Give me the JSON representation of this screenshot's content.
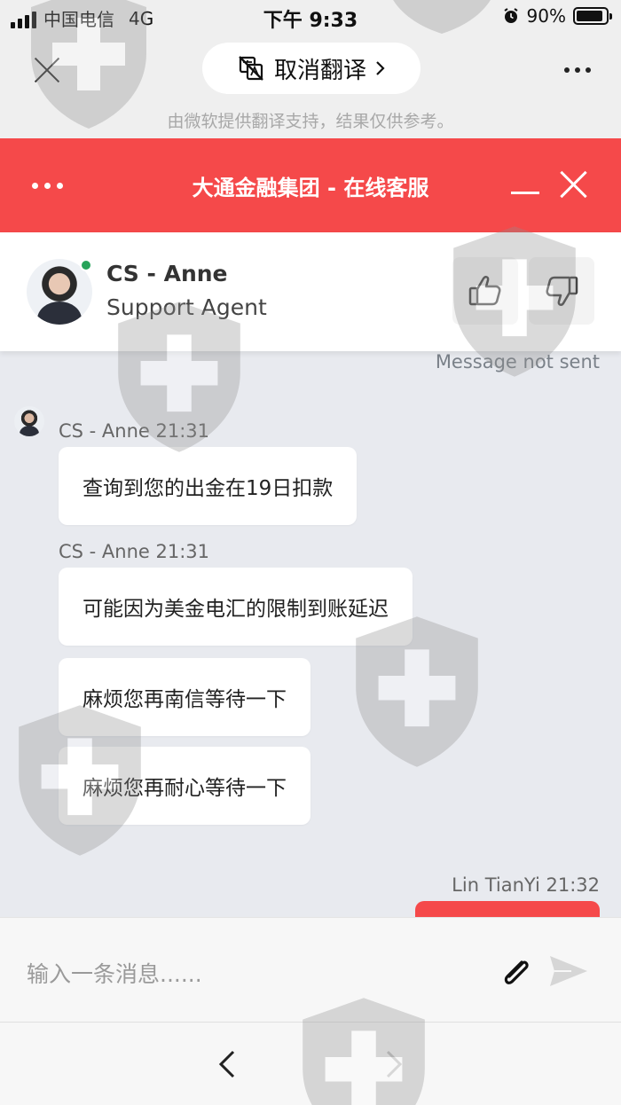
{
  "status_bar": {
    "carrier": "中国电信",
    "network": "4G",
    "time": "下午 9:33",
    "battery": "90%",
    "battery_level": 0.9
  },
  "translate_bar": {
    "pill_label": "取消翻译",
    "note": "由微软提供翻译支持，结果仅供参考。"
  },
  "chat_header": {
    "title": "大通金融集团 - 在线客服"
  },
  "agent": {
    "name": "CS - Anne",
    "role": "Support Agent"
  },
  "messages": {
    "not_sent": "Message not sent",
    "group1_meta": "CS - Anne 21:31",
    "group1_bubble": "查询到您的出金在19日扣款",
    "group2_meta": "CS - Anne 21:31",
    "group2_bubble1": "可能因为美金电汇的限制到账延迟",
    "group2_bubble2": "麻烦您再南信等待一下",
    "group2_bubble3": "麻烦您再耐心等待一下",
    "user_meta": "Lin TianYi 21:32"
  },
  "input": {
    "placeholder": "输入一条消息......"
  },
  "colors": {
    "brand_red": "#f5494a",
    "online_green": "#27a35a",
    "chat_bg": "#e8eaef"
  }
}
